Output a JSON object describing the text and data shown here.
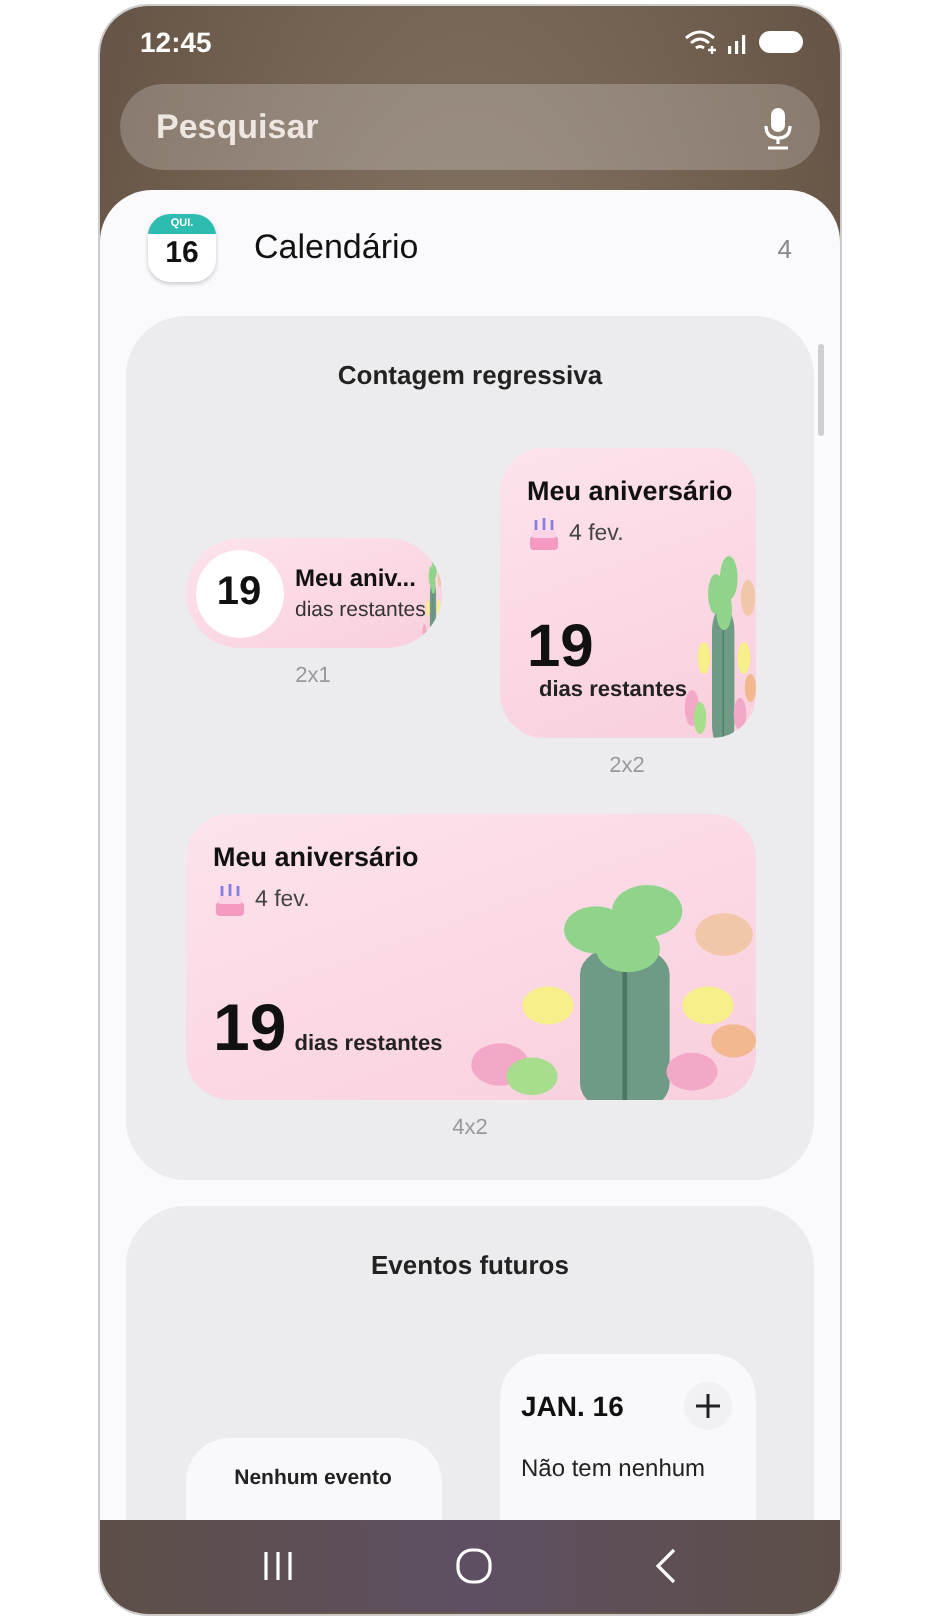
{
  "status_bar": {
    "time": "12:45"
  },
  "search": {
    "placeholder": "Pesquisar"
  },
  "app": {
    "icon_weekday": "QUI.",
    "icon_day": "16",
    "name": "Calendário",
    "count": "4"
  },
  "sections": [
    {
      "title": "Contagem regressiva",
      "widgets": [
        {
          "kind": "pill",
          "number": "19",
          "title": "Meu aniv...",
          "subtitle": "dias restantes",
          "size_label": "2x1"
        },
        {
          "kind": "square",
          "title": "Meu aniversário",
          "date": "4 fev.",
          "number": "19",
          "subtitle": "dias restantes",
          "size_label": "2x2"
        },
        {
          "kind": "wide",
          "title": "Meu aniversário",
          "date": "4 fev.",
          "number": "19",
          "subtitle": "dias restantes",
          "size_label": "4x2"
        }
      ]
    },
    {
      "title": "Eventos futuros",
      "widgets": [
        {
          "kind": "empty",
          "text": "Nenhum evento"
        },
        {
          "kind": "day",
          "date": "JAN. 16",
          "text": "Não tem nenhum"
        }
      ]
    }
  ]
}
